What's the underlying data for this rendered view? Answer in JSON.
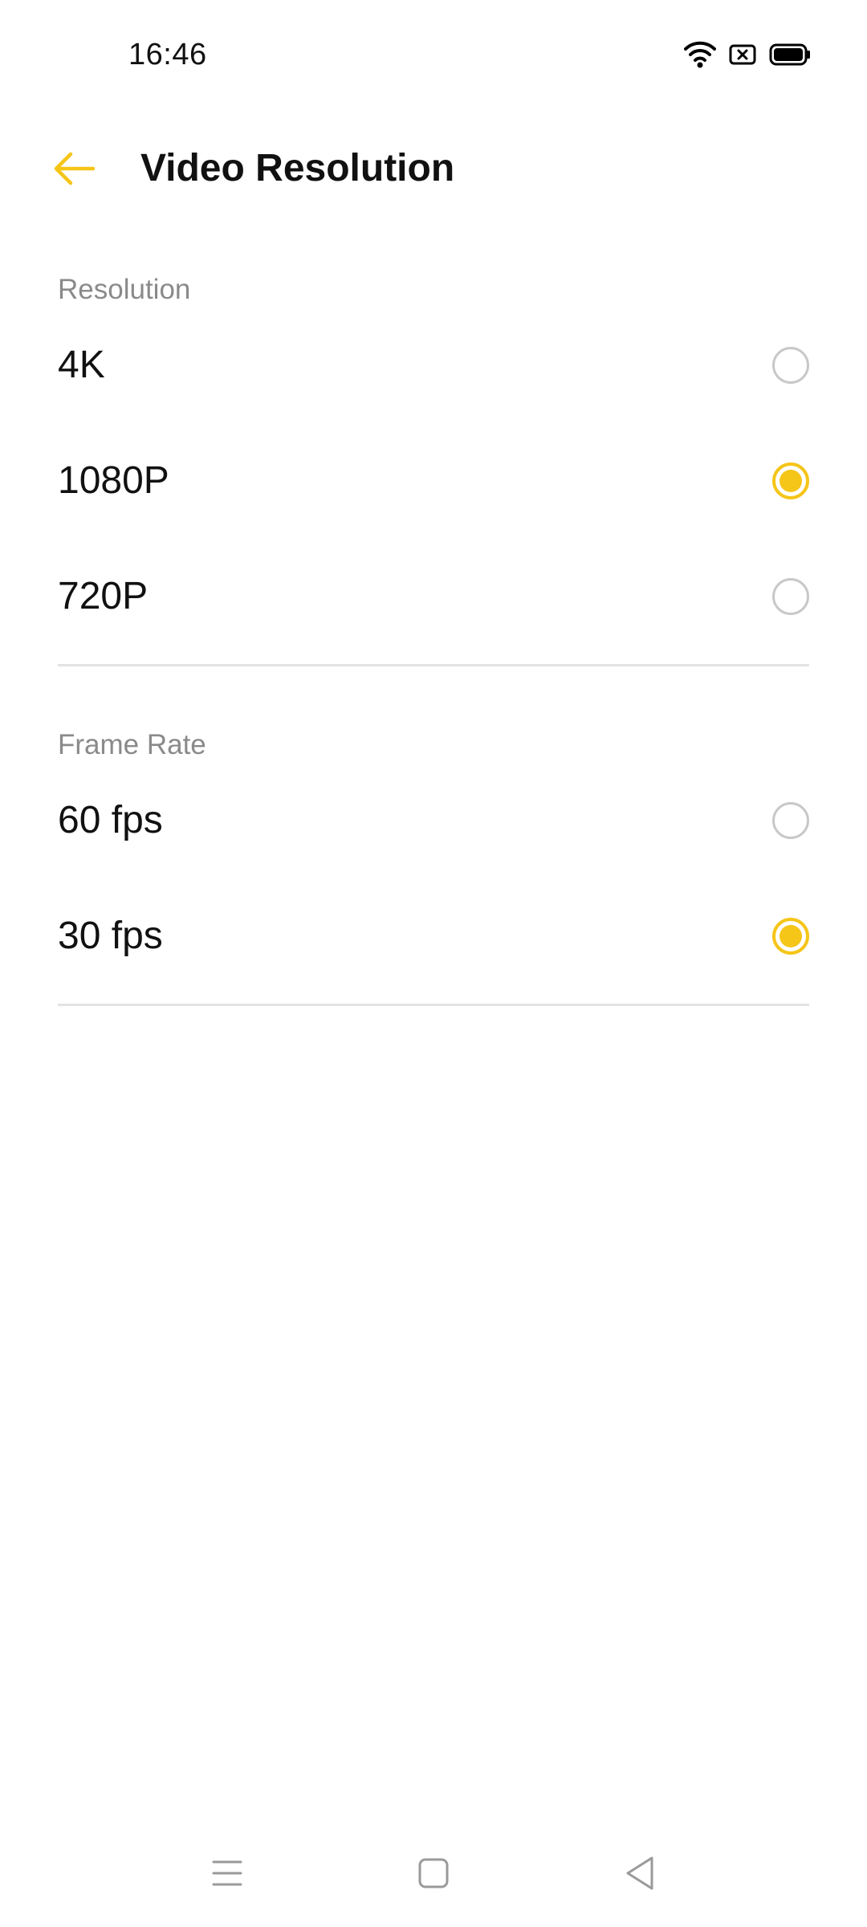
{
  "status_bar": {
    "time": "16:46",
    "icons": [
      "wifi-icon",
      "no-sim-icon",
      "battery-icon"
    ]
  },
  "app_bar": {
    "title": "Video Resolution",
    "back_icon": "arrow-left-icon"
  },
  "resolution_section": {
    "header": "Resolution",
    "options": [
      {
        "label": "4K",
        "selected": false
      },
      {
        "label": "1080P",
        "selected": true
      },
      {
        "label": "720P",
        "selected": false
      }
    ]
  },
  "frame_rate_section": {
    "header": "Frame Rate",
    "options": [
      {
        "label": "60 fps",
        "selected": false
      },
      {
        "label": "30 fps",
        "selected": true
      }
    ]
  },
  "nav_bar": {
    "icons": [
      "menu-icon",
      "home-icon",
      "back-icon"
    ]
  },
  "colors": {
    "accent": "#f5c518",
    "section_header": "#8a8a8a",
    "divider": "#e3e3e3",
    "radio_unchecked": "#c8c8c8"
  }
}
